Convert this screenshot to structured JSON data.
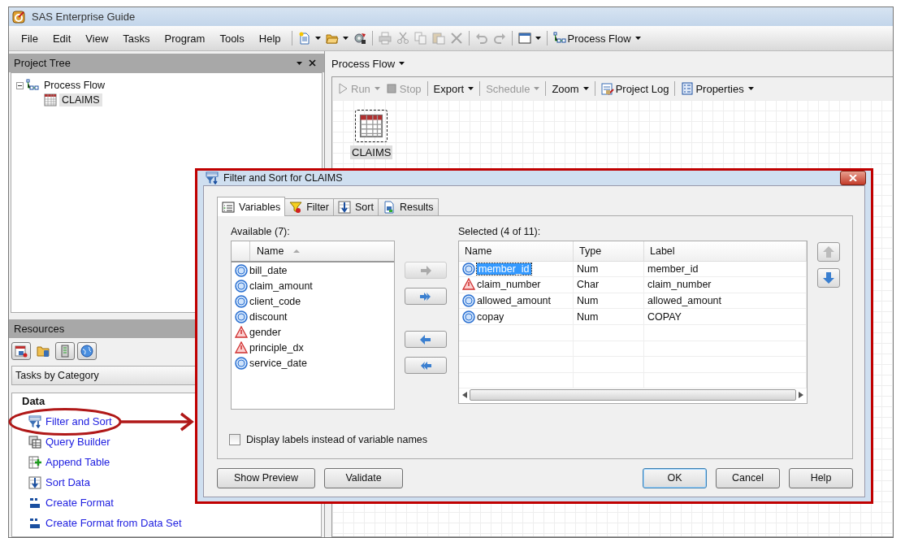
{
  "window": {
    "title": "SAS Enterprise Guide"
  },
  "menu": [
    "File",
    "Edit",
    "View",
    "Tasks",
    "Program",
    "Tools",
    "Help"
  ],
  "toolbar": [
    {
      "kind": "new",
      "dropdown": true,
      "disabled": false
    },
    {
      "kind": "open",
      "dropdown": true,
      "disabled": false
    },
    {
      "kind": "gear",
      "dropdown": false,
      "disabled": false
    },
    {
      "kind": "print",
      "dropdown": false,
      "disabled": true
    },
    {
      "kind": "cut",
      "dropdown": false,
      "disabled": true
    },
    {
      "kind": "copy",
      "dropdown": false,
      "disabled": true
    },
    {
      "kind": "paste",
      "dropdown": false,
      "disabled": true
    },
    {
      "kind": "delete",
      "dropdown": false,
      "disabled": true
    },
    {
      "kind": "undo",
      "dropdown": false,
      "disabled": true
    },
    {
      "kind": "redo",
      "dropdown": false,
      "disabled": true
    },
    {
      "kind": "window",
      "dropdown": true,
      "disabled": false
    },
    {
      "kind": "flow",
      "label": "Process Flow",
      "dropdown": true,
      "disabled": false
    }
  ],
  "project_tree": {
    "title": "Project Tree",
    "items": [
      {
        "label": "Process Flow",
        "kind": "flow",
        "expanded": true,
        "selected": false,
        "children": [
          {
            "label": "CLAIMS",
            "kind": "table",
            "selected": true
          }
        ]
      }
    ]
  },
  "resources": {
    "title": "Resources",
    "views": [
      {
        "kind": "tasks",
        "selected": true
      },
      {
        "kind": "server-folder",
        "selected": false
      },
      {
        "kind": "server",
        "selected": true
      },
      {
        "kind": "globe",
        "selected": true
      }
    ],
    "view_select": "Tasks by Category",
    "category": "Data",
    "tasks": [
      {
        "label": "Filter and Sort",
        "kind": "filter"
      },
      {
        "label": "Query Builder",
        "kind": "query"
      },
      {
        "label": "Append Table",
        "kind": "append"
      },
      {
        "label": "Sort Data",
        "kind": "sort"
      },
      {
        "label": "Create Format",
        "kind": "format"
      },
      {
        "label": "Create Format from Data Set",
        "kind": "format"
      }
    ]
  },
  "process_flow": {
    "tab": "Process Flow",
    "toolbar": [
      {
        "label": "Run",
        "kind": "run",
        "dropdown": true,
        "disabled": true
      },
      {
        "label": "Stop",
        "kind": "stop",
        "dropdown": false,
        "disabled": true
      },
      {
        "label": "Export",
        "dropdown": true,
        "disabled": false
      },
      {
        "label": "Schedule",
        "dropdown": true,
        "disabled": true
      },
      {
        "label": "Zoom",
        "dropdown": true,
        "disabled": false
      },
      {
        "label": "Project Log",
        "kind": "log",
        "dropdown": false,
        "disabled": false
      },
      {
        "label": "Properties",
        "kind": "properties",
        "dropdown": true,
        "disabled": false
      }
    ],
    "nodes": [
      {
        "label": "CLAIMS",
        "selected": true
      }
    ]
  },
  "dialog": {
    "title": "Filter and Sort for CLAIMS",
    "tabs": [
      {
        "label": "Variables",
        "kind": "variables",
        "selected": true
      },
      {
        "label": "Filter",
        "kind": "funnel",
        "selected": false
      },
      {
        "label": "Sort",
        "kind": "sort",
        "selected": false
      },
      {
        "label": "Results",
        "kind": "results",
        "selected": false
      }
    ],
    "available": {
      "label": "Available (7):",
      "column": "Name",
      "items": [
        {
          "name": "bill_date",
          "kind": "num"
        },
        {
          "name": "claim_amount",
          "kind": "num"
        },
        {
          "name": "client_code",
          "kind": "num"
        },
        {
          "name": "discount",
          "kind": "num"
        },
        {
          "name": "gender",
          "kind": "char"
        },
        {
          "name": "principle_dx",
          "kind": "char"
        },
        {
          "name": "service_date",
          "kind": "num"
        }
      ]
    },
    "move_buttons": [
      {
        "kind": "right",
        "disabled": true
      },
      {
        "kind": "all-right",
        "disabled": false
      },
      {
        "kind": "left",
        "disabled": false
      },
      {
        "kind": "all-left",
        "disabled": false
      }
    ],
    "selected": {
      "label": "Selected (4 of 11):",
      "columns": [
        "Name",
        "Type",
        "Label"
      ],
      "rows": [
        {
          "name": "member_id",
          "kind": "num",
          "type": "Num",
          "label": "member_id",
          "selected": true
        },
        {
          "name": "claim_number",
          "kind": "char",
          "type": "Char",
          "label": "claim_number",
          "selected": false
        },
        {
          "name": "allowed_amount",
          "kind": "num",
          "type": "Num",
          "label": "allowed_amount",
          "selected": false
        },
        {
          "name": "copay",
          "kind": "num",
          "type": "Num",
          "label": "COPAY",
          "selected": false
        }
      ]
    },
    "order_buttons": [
      {
        "kind": "up",
        "disabled": true
      },
      {
        "kind": "down",
        "disabled": false
      }
    ],
    "checkbox": {
      "label": "Display labels instead of variable names",
      "checked": false
    },
    "buttons": [
      {
        "label": "Show Preview",
        "default": false
      },
      {
        "label": "Validate",
        "default": false
      },
      {
        "label": "OK",
        "default": true
      },
      {
        "label": "Cancel",
        "default": false
      },
      {
        "label": "Help",
        "default": false
      }
    ]
  }
}
